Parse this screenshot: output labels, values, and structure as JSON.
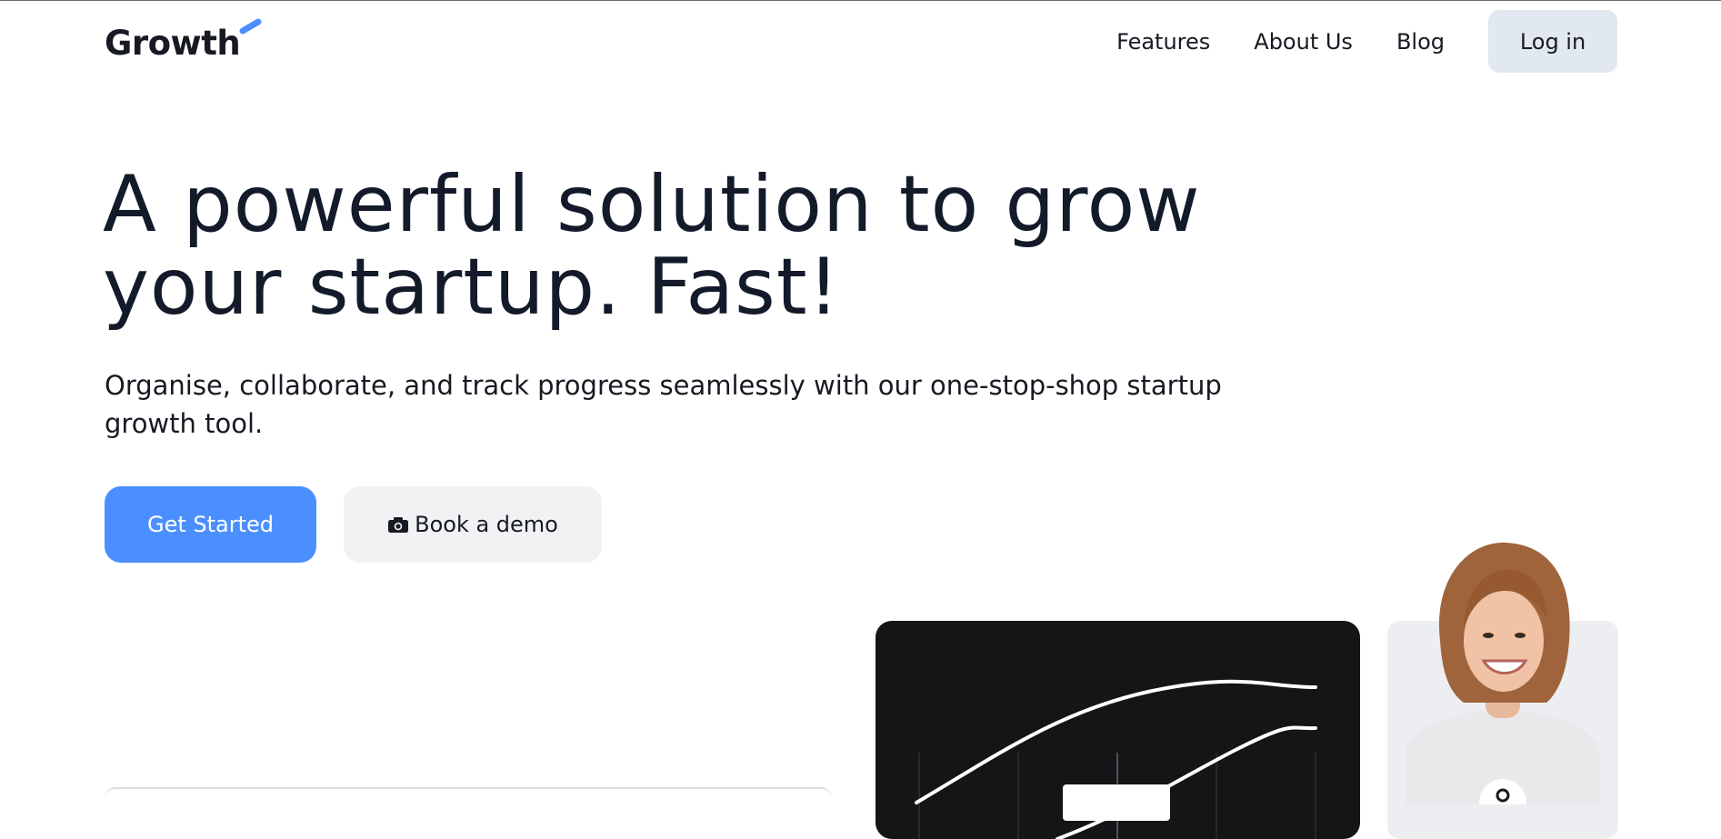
{
  "brand": {
    "name": "Growth",
    "accent_color": "#4b8fff"
  },
  "nav": {
    "links": [
      "Features",
      "About Us",
      "Blog"
    ],
    "login_label": "Log in"
  },
  "hero": {
    "title_line1": "A powerful solution to grow",
    "title_line2": "your startup. Fast!",
    "subtitle": "Organise, collaborate, and track progress seamlessly with our one-stop-shop startup growth tool.",
    "primary_cta": "Get Started",
    "secondary_cta": "Book a demo",
    "secondary_cta_icon": "camera-icon"
  },
  "colors": {
    "text": "#131a2a",
    "primary_button": "#4b8fff",
    "secondary_button": "#f1f2f4",
    "login_button": "#e2e8f0",
    "chart_card": "#141517"
  }
}
